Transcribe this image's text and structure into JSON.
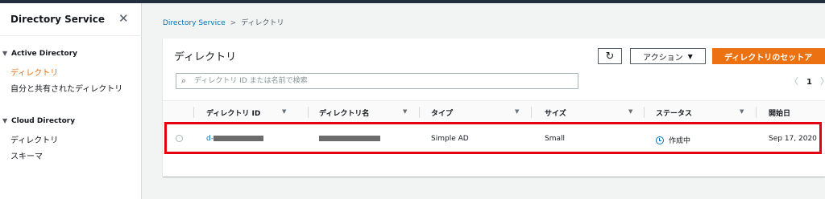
{
  "sidebar": {
    "title": "Directory Service",
    "close_glyph": "✕",
    "sections": [
      {
        "label": "Active Directory",
        "items": [
          {
            "label": "ディレクトリ",
            "active": true
          },
          {
            "label": "自分と共有されたディレクトリ",
            "active": false
          }
        ]
      },
      {
        "label": "Cloud Directory",
        "items": [
          {
            "label": "ディレクトリ",
            "active": false
          },
          {
            "label": "スキーマ",
            "active": false
          }
        ]
      }
    ]
  },
  "breadcrumb": {
    "root": "Directory Service",
    "separator": ">",
    "current": "ディレクトリ"
  },
  "panel": {
    "title": "ディレクトリ",
    "refresh_glyph": "↻",
    "action_label": "アクション",
    "action_caret": "▼",
    "primary_label": "ディレクトリのセットア",
    "search_placeholder": "ディレクトリ ID または名前で検索",
    "search_icon_glyph": "🔍",
    "pager": {
      "prev": "〈",
      "page": "1",
      "next": "〉"
    }
  },
  "table": {
    "sort_glyph": "▼",
    "columns": [
      "ディレクトリ ID",
      "ディレクトリ名",
      "タイプ",
      "サイズ",
      "ステータス",
      "開始日"
    ],
    "rows": [
      {
        "directory_id_prefix": "d-",
        "type": "Simple AD",
        "size": "Small",
        "status": "作成中",
        "start_date": "Sep 17, 2020"
      }
    ]
  },
  "colors": {
    "accent": "#ec7211",
    "link": "#0073bb",
    "highlight": "#e3000f",
    "nav_dark": "#232f3e"
  }
}
